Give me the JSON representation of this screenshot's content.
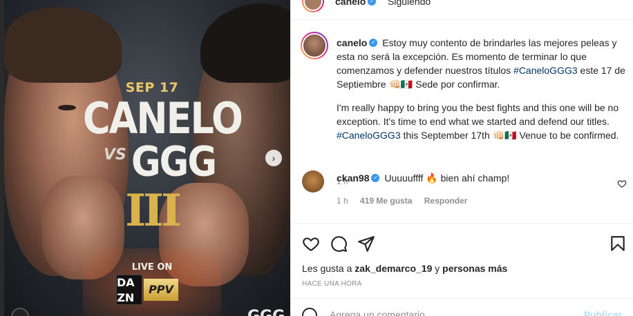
{
  "poster": {
    "date": "SEP 17",
    "fighter1": "CANELO",
    "vs": "VS",
    "fighter2": "GGG",
    "numeral": "III",
    "live_on": "LIVE ON",
    "dazn_letters": [
      "DA",
      "ZN"
    ],
    "ppv": "PPV",
    "corner_logo": "GGG",
    "next_icon": "chevron-right-icon"
  },
  "header": {
    "username": "canelo",
    "follow_status": "Siguiendo"
  },
  "caption": {
    "username": "canelo",
    "text_es_1": "Estoy muy contento de brindarles las mejores peleas y esta no será la excepción. Es momento de terminar lo que comenzamos y defender nuestros títulos",
    "hashtag": "#CaneloGGG3",
    "text_es_2": "este 17 de Septiembre",
    "flag_emoji": "👊🏻🇲🇽",
    "text_es_3": "Sede por confirmar.",
    "text_en_1": "I'm really happy to bring you the best fights and this one will be no exception. It's time to end what we started and defend our titles.",
    "text_en_2": "this September 17th",
    "text_en_3": "Venue to be confirmed.",
    "time": "1 h"
  },
  "comment": {
    "username": "ckan98",
    "text": "Uuuuuffff 🔥 bien ahí champ!",
    "time": "1 h",
    "likes": "419 Me gusta",
    "reply": "Responder"
  },
  "actions": {
    "like_icon": "heart-icon",
    "comment_icon": "comment-icon",
    "share_icon": "send-icon",
    "save_icon": "bookmark-icon"
  },
  "likes": {
    "prefix": "Les gusta a",
    "user": "zak_demarco_19",
    "suffix_connector": "y",
    "others": "personas más"
  },
  "post_time": "HACE UNA HORA",
  "add_comment": {
    "placeholder": "Agrega un comentario...",
    "publish": "Publicar"
  },
  "colors": {
    "link": "#00376b",
    "verified": "#3897f0",
    "muted": "#8e8e8e",
    "poster_gold": "#d9b24e"
  }
}
